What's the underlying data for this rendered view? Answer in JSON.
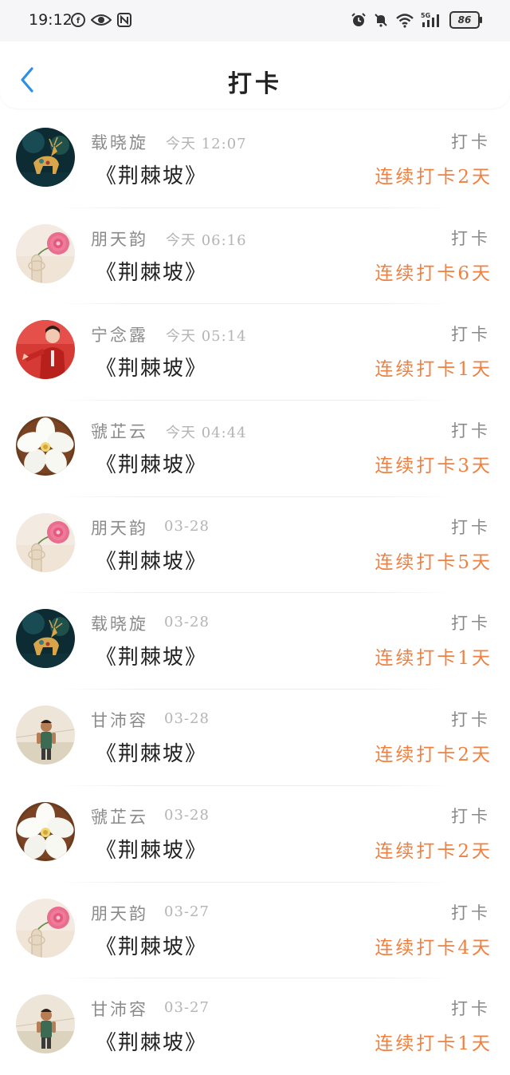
{
  "status_bar": {
    "time": "19:12",
    "battery": "86",
    "network": "5G"
  },
  "header": {
    "title": "打卡"
  },
  "colors": {
    "accent_blue": "#2d8fe6",
    "streak_orange": "#f08040",
    "name_gray": "#8a8a8a",
    "time_gray": "#b4b4b4"
  },
  "entries": [
    {
      "name": "载晓旋",
      "time": "今天 12:07",
      "book": "《荆棘坡》",
      "type": "打卡",
      "streak": "连续打卡2天",
      "avatar": "deer-painting"
    },
    {
      "name": "朋天韵",
      "time": "今天 06:16",
      "book": "《荆棘坡》",
      "type": "打卡",
      "streak": "连续打卡6天",
      "avatar": "pink-flower-vase"
    },
    {
      "name": "宁念露",
      "time": "今天 05:14",
      "book": "《荆棘坡》",
      "type": "打卡",
      "streak": "连续打卡1天",
      "avatar": "red-suit-person"
    },
    {
      "name": "虢芷云",
      "time": "今天 04:44",
      "book": "《荆棘坡》",
      "type": "打卡",
      "streak": "连续打卡3天",
      "avatar": "white-flower"
    },
    {
      "name": "朋天韵",
      "time": "03-28",
      "book": "《荆棘坡》",
      "type": "打卡",
      "streak": "连续打卡5天",
      "avatar": "pink-flower-vase"
    },
    {
      "name": "载晓旋",
      "time": "03-28",
      "book": "《荆棘坡》",
      "type": "打卡",
      "streak": "连续打卡1天",
      "avatar": "deer-painting"
    },
    {
      "name": "甘沛容",
      "time": "03-28",
      "book": "《荆棘坡》",
      "type": "打卡",
      "streak": "连续打卡2天",
      "avatar": "child-photo"
    },
    {
      "name": "虢芷云",
      "time": "03-28",
      "book": "《荆棘坡》",
      "type": "打卡",
      "streak": "连续打卡2天",
      "avatar": "white-flower"
    },
    {
      "name": "朋天韵",
      "time": "03-27",
      "book": "《荆棘坡》",
      "type": "打卡",
      "streak": "连续打卡4天",
      "avatar": "pink-flower-vase"
    },
    {
      "name": "甘沛容",
      "time": "03-27",
      "book": "《荆棘坡》",
      "type": "打卡",
      "streak": "连续打卡1天",
      "avatar": "child-photo"
    }
  ]
}
